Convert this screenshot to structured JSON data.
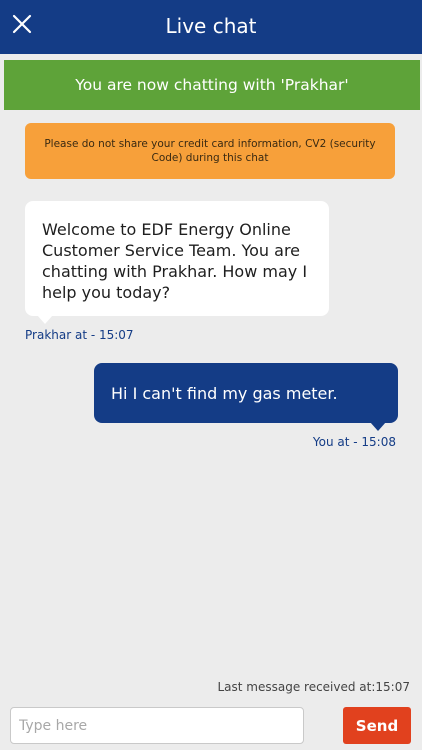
{
  "header": {
    "title": "Live chat",
    "close_icon": "close-icon"
  },
  "status_banner": {
    "text": "You are now chatting with 'Prakhar'"
  },
  "warning": {
    "text": "Please do not share your credit card information, CV2 (security Code) during this chat"
  },
  "messages": [
    {
      "sender": "agent",
      "text": "Welcome to EDF Energy Online Customer Service Team. You are chatting with Prakhar. How may I help you today?",
      "meta": "Prakhar at - 15:07"
    },
    {
      "sender": "user",
      "text": "Hi I can't find my gas meter.",
      "meta": "You at - 15:08"
    }
  ],
  "last_received": "Last message received at:15:07",
  "composer": {
    "placeholder": "Type here",
    "value": "",
    "send_label": "Send"
  },
  "colors": {
    "header": "#143c86",
    "status_banner": "#5ea339",
    "warning": "#f7a03a",
    "send_button": "#e1411e",
    "background": "#ececec"
  }
}
